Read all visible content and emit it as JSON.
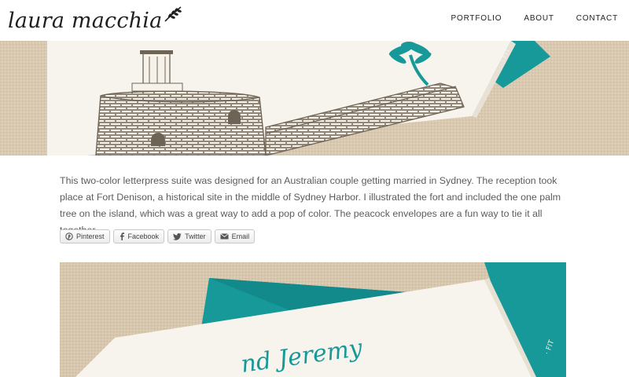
{
  "header": {
    "logo_text": "laura macchia",
    "nav": [
      {
        "label": "PORTFOLIO"
      },
      {
        "label": "ABOUT"
      },
      {
        "label": "CONTACT"
      }
    ]
  },
  "post": {
    "description": "This two-color letterpress suite was designed for an Australian couple getting married in Sydney. The reception took place at Fort Denison, a historical site in the middle of Sydney Harbor. I illustrated the fort and included the one palm tree on the island, which was a great way to add a pop of color. The peacock envelopes are a fun way to tie it all together."
  },
  "share": {
    "buttons": [
      {
        "label": "Pinterest",
        "icon": "pinterest-icon"
      },
      {
        "label": "Facebook",
        "icon": "facebook-icon"
      },
      {
        "label": "Twitter",
        "icon": "twitter-icon"
      },
      {
        "label": "Email",
        "icon": "email-icon"
      }
    ]
  },
  "photo2": {
    "card_text": "nd Jeremy",
    "envelope_text": "· FIT"
  },
  "colors": {
    "teal": "#17999a",
    "linen": "#d8c8af",
    "card": "#f7f4ee",
    "ink": "#6e6455"
  }
}
